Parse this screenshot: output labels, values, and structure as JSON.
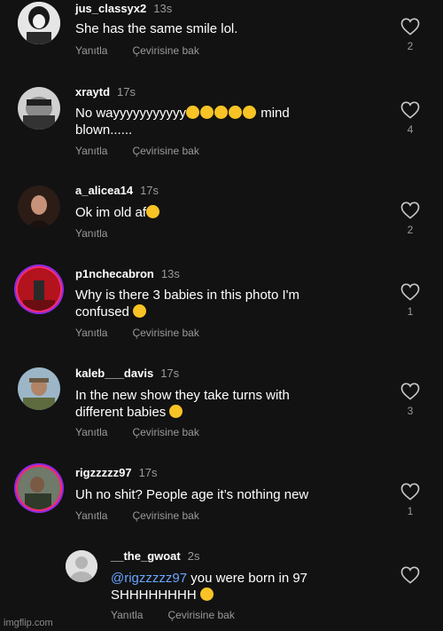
{
  "colors": {
    "background": "#121212",
    "text": "#ffffff",
    "meta": "#9a9a9a",
    "mention": "#6aa5ff"
  },
  "actions": {
    "reply": "Yanıtla",
    "translate": "Çevirisine bak"
  },
  "comments": [
    {
      "username": "jus_classyx2",
      "time": "13s",
      "text": "She has the same smile lol.",
      "likes": "2"
    },
    {
      "username": "xraytd",
      "time": "17s",
      "text": "No wayyyyyyyyyyy",
      "text_after": "mind blown......",
      "likes": "4"
    },
    {
      "username": "a_alicea14",
      "time": "17s",
      "text": "Ok im old af",
      "likes": "2"
    },
    {
      "username": "p1nchecabron",
      "time": "13s",
      "text": "Why is there 3 babies in this photo I'm confused",
      "likes": "1"
    },
    {
      "username": "kaleb___davis",
      "time": "17s",
      "text": "In the new show they take turns with different babies",
      "likes": "3"
    },
    {
      "username": "rigzzzzz97",
      "time": "17s",
      "text": "Uh no shit? People age it’s nothing new",
      "likes": "1"
    }
  ],
  "reply": {
    "username": "__the_gwoat",
    "time": "2s",
    "mention": "@rigzzzzz97",
    "text": " you were born in 97 SHHHHHHHH"
  },
  "watermark": "imgflip.com"
}
